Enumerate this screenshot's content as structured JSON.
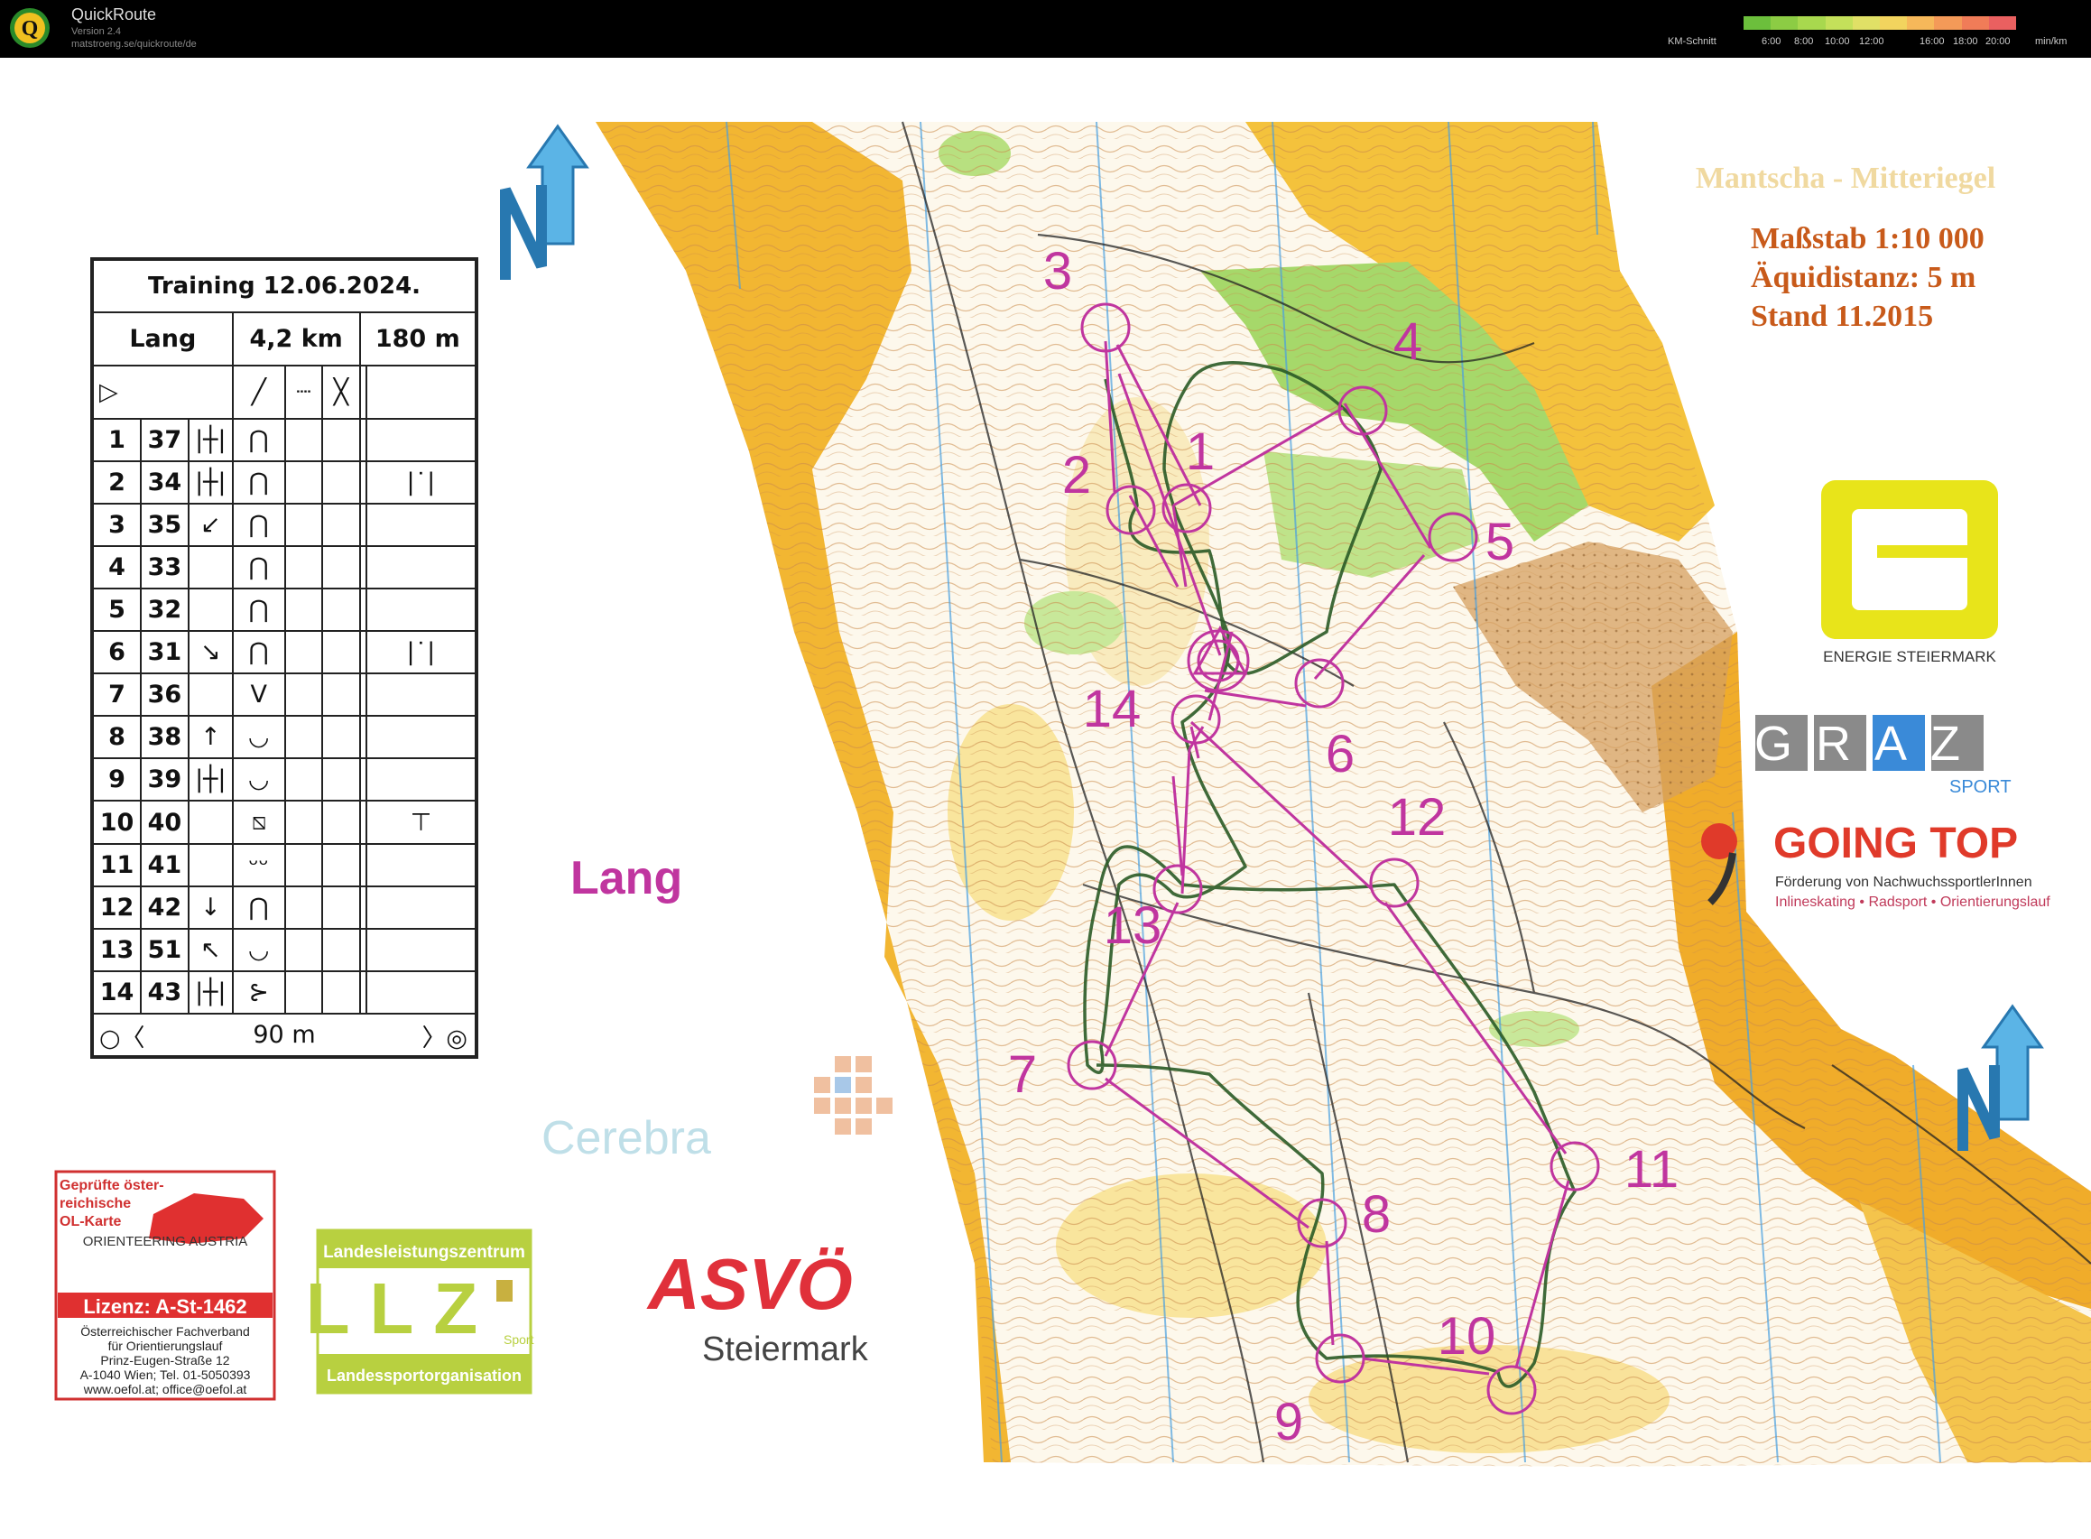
{
  "app": {
    "title": "QuickRoute",
    "version": "Version 2.4",
    "url": "matstroeng.se/quickroute/de",
    "pace_label": "KM-Schnitt",
    "pace_ticks": [
      "6:00",
      "8:00",
      "10:00",
      "12:00",
      "16:00",
      "18:00",
      "20:00"
    ],
    "pace_unit": "min/km",
    "legend_colors": [
      "#6cbf3c",
      "#8ccc44",
      "#a8d84e",
      "#c4e05a",
      "#e0e066",
      "#f2d45e",
      "#f6b85a",
      "#f49a58",
      "#f07c58",
      "#ea6060"
    ]
  },
  "map": {
    "course_label": "Lang",
    "map_name": "Mantscha - Mitteriegel",
    "scale": "Maßstab 1:10 000",
    "equidistance": "Äquidistanz: 5 m",
    "stand": "Stand 11.2015",
    "course_color": "#c0359f",
    "route_color": "#2a5a26",
    "controls": [
      "3",
      "4",
      "1",
      "2",
      "5",
      "14",
      "6",
      "12",
      "13",
      "7",
      "11",
      "8",
      "10",
      "9"
    ]
  },
  "control_description": {
    "title": "Training 12.06.2024.",
    "course": "Lang",
    "length": "4,2 km",
    "climb": "180 m",
    "start_symbol": "▷",
    "finish_distance": "90 m",
    "rows": [
      {
        "num": "1",
        "code": "37",
        "feature": "|┼|",
        "detail": "⋂",
        "extra": ""
      },
      {
        "num": "2",
        "code": "34",
        "feature": "|┼|",
        "detail": "⋂",
        "extra": "|˙|"
      },
      {
        "num": "3",
        "code": "35",
        "feature": "↙",
        "detail": "⋂",
        "extra": ""
      },
      {
        "num": "4",
        "code": "33",
        "feature": "",
        "detail": "⋂",
        "extra": ""
      },
      {
        "num": "5",
        "code": "32",
        "feature": "",
        "detail": "⋂",
        "extra": ""
      },
      {
        "num": "6",
        "code": "31",
        "feature": "↘",
        "detail": "⋂",
        "extra": "|˙|"
      },
      {
        "num": "7",
        "code": "36",
        "feature": "",
        "detail": "V",
        "extra": ""
      },
      {
        "num": "8",
        "code": "38",
        "feature": "↑",
        "detail": "◡",
        "extra": ""
      },
      {
        "num": "9",
        "code": "39",
        "feature": "|┼|",
        "detail": "◡",
        "extra": ""
      },
      {
        "num": "10",
        "code": "40",
        "feature": "",
        "detail": "⧅",
        "extra": "⊤"
      },
      {
        "num": "11",
        "code": "41",
        "feature": "",
        "detail": "ᵕᵕ",
        "extra": ""
      },
      {
        "num": "12",
        "code": "42",
        "feature": "↓",
        "detail": "⋂",
        "extra": ""
      },
      {
        "num": "13",
        "code": "51",
        "feature": "↖",
        "detail": "◡",
        "extra": ""
      },
      {
        "num": "14",
        "code": "43",
        "feature": "|┼|",
        "detail": "⊱",
        "extra": ""
      }
    ]
  },
  "sponsors": {
    "energie": "ENERGIE STEIERMARK",
    "graz": "GRAZ",
    "graz_sub": "SPORT",
    "going_top": "GOING TOP",
    "going_top_sub": "Förderung von NachwuchssportlerInnen",
    "going_top_sub2": "Inlineskating • Radsport • Orientierungslauf",
    "cerebra": "Cerebra",
    "asvo": "ASVÖ",
    "asvo_sub": "Steiermark",
    "llz_top": "Landesleistungszentrum",
    "llz": "LLZ",
    "llz_sport": "Sport",
    "llz_bottom": "Landessportorganisation",
    "oefol_l1": "Geprüfte öster-",
    "oefol_l2": "reichische",
    "oefol_l3": "OL-Karte",
    "oefol_l4": "ORIENTEERING AUSTRIA",
    "oefol_lizenz": "Lizenz: A-St-1462",
    "oefol_a1": "Österreichischer Fachverband",
    "oefol_a2": "für Orientierungslauf",
    "oefol_a3": "Prinz-Eugen-Straße 12",
    "oefol_a4": "A-1040 Wien; Tel. 01-5050393",
    "oefol_a5": "www.oefol.at; office@oefol.at"
  }
}
